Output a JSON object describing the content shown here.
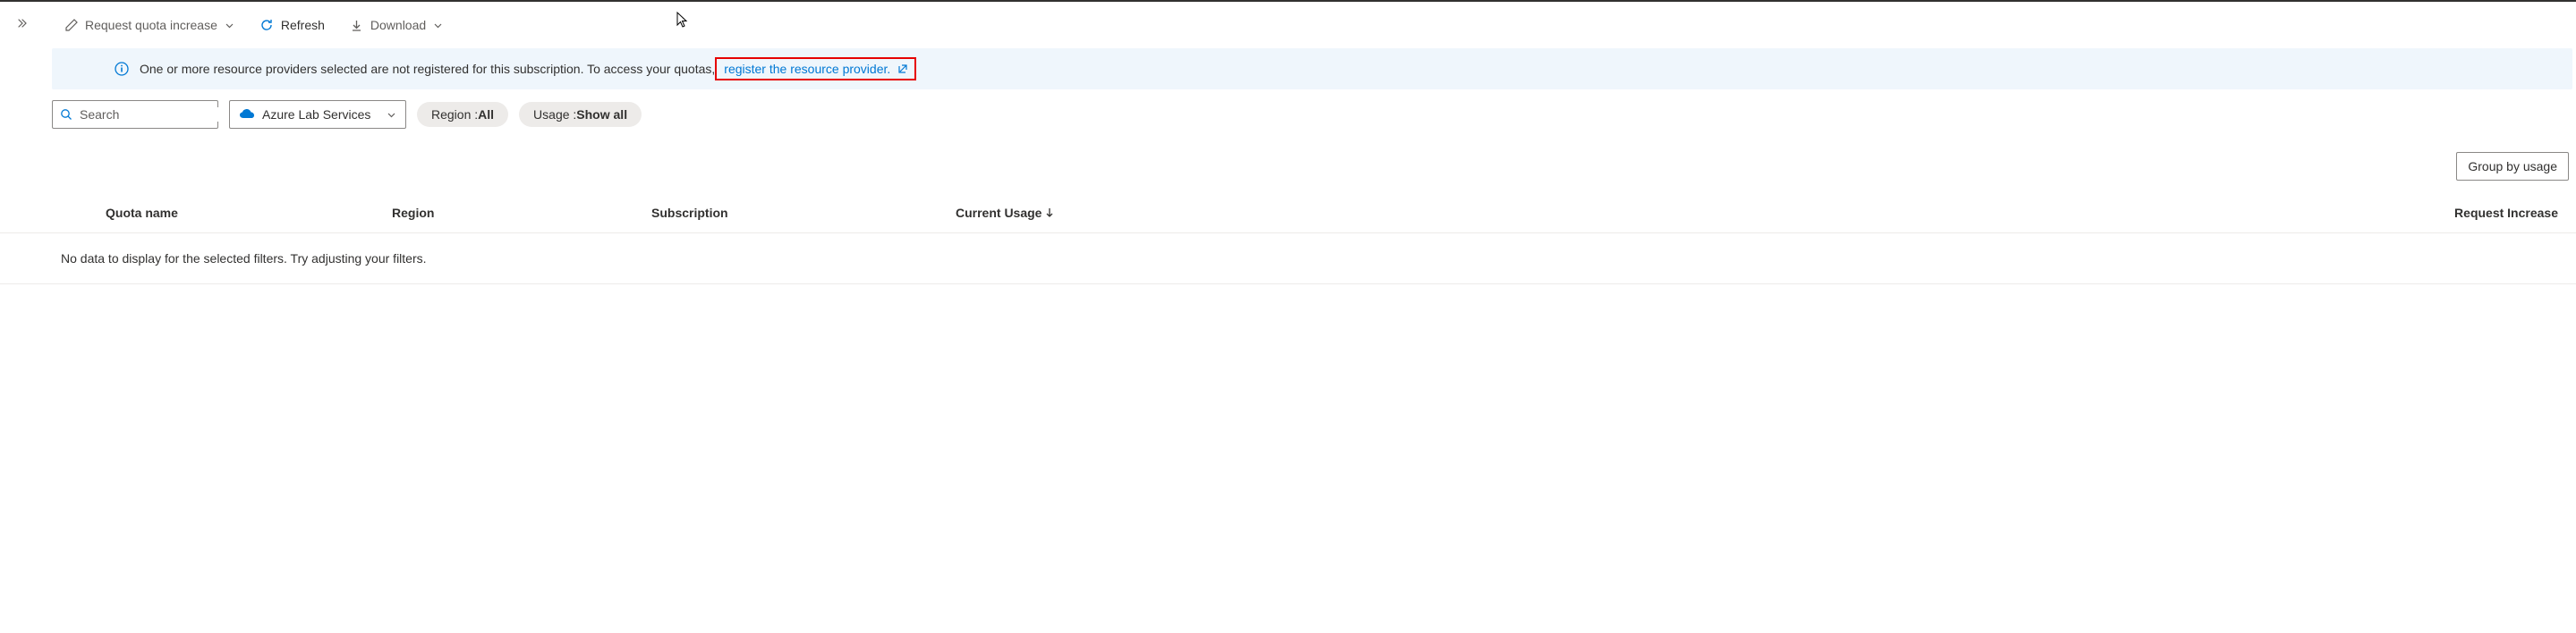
{
  "toolbar": {
    "request_quota_label": "Request quota increase",
    "refresh_label": "Refresh",
    "download_label": "Download"
  },
  "banner": {
    "message": "One or more resource providers selected are not registered for this subscription. To access your quotas, ",
    "link_text": "register the resource provider."
  },
  "filters": {
    "search_placeholder": "Search",
    "provider_label": "Azure Lab Services",
    "region_label": "Region : ",
    "region_value": "All",
    "usage_label": "Usage : ",
    "usage_value": "Show all"
  },
  "group_by": {
    "label": "Group by usage"
  },
  "table": {
    "columns": {
      "quota_name": "Quota name",
      "region": "Region",
      "subscription": "Subscription",
      "current_usage": "Current Usage",
      "request_increase": "Request Increase"
    },
    "empty_message": "No data to display for the selected filters. Try adjusting your filters."
  }
}
